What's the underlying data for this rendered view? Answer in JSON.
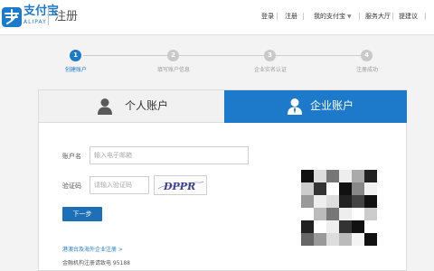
{
  "header": {
    "logo_cn": "支付宝",
    "logo_en": "ALIPAY",
    "page_title": "注册",
    "nav": {
      "login": "登录",
      "register": "注册",
      "my_alipay": "我的支付宝",
      "service_hall": "服务大厅",
      "feedback": "提建议",
      "more": "|"
    }
  },
  "steps": [
    {
      "num": "1",
      "label": "创建账户",
      "active": true
    },
    {
      "num": "2",
      "label": "填写账户信息",
      "active": false
    },
    {
      "num": "3",
      "label": "企业实名认证",
      "active": false
    },
    {
      "num": "4",
      "label": "注册成功",
      "active": false
    }
  ],
  "tabs": {
    "personal": "个人账户",
    "business": "企业账户"
  },
  "form": {
    "account_label": "账户名",
    "account_placeholder": "输入电子邮箱",
    "captcha_label": "验证码",
    "captcha_placeholder": "请输入验证码",
    "captcha_text": "DPPR",
    "next_button": "下一步",
    "link_text": "港澳台及海外企业注册 >",
    "footer_text": "金融机构注册请致电 95188"
  },
  "colors": {
    "brand_blue": "#1d7acb",
    "step_inactive": "#c9c9c9"
  }
}
